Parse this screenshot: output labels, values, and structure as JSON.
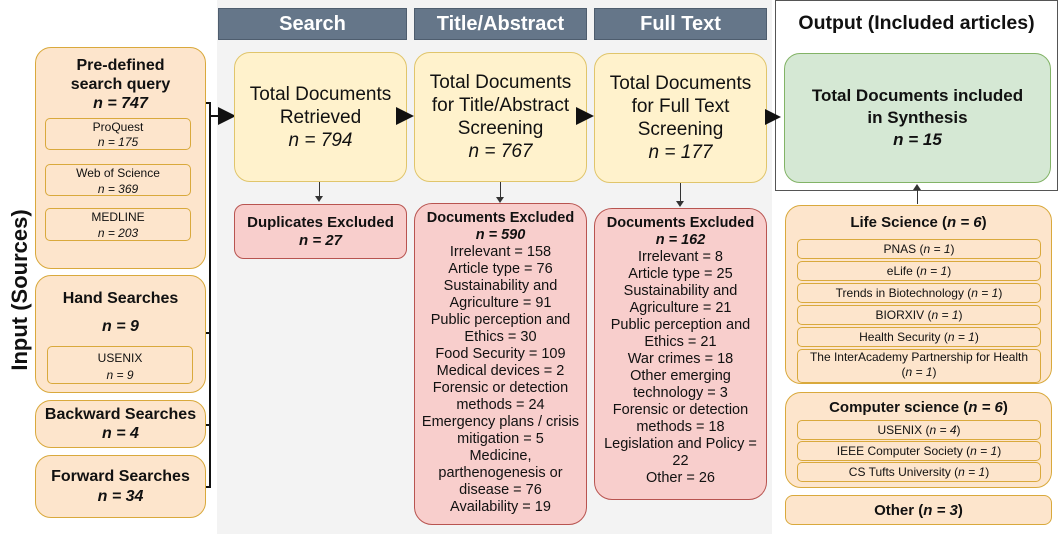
{
  "side_label": "Input (Sources)",
  "stages": {
    "search": "Search",
    "title_abstract": "Title/Abstract",
    "full_text": "Full Text",
    "output": "Output (Included articles)"
  },
  "inputs": {
    "predefined": {
      "title_line1": "Pre-defined",
      "title_line2": "search query",
      "n": "n = 747",
      "sources": [
        {
          "name": "ProQuest",
          "n": "n = 175"
        },
        {
          "name": "Web of Science",
          "n": "n = 369"
        },
        {
          "name": "MEDLINE",
          "n": "n = 203"
        }
      ]
    },
    "hand": {
      "title": "Hand Searches",
      "n": "n = 9",
      "sources": [
        {
          "name": "USENIX",
          "n": "n = 9"
        }
      ]
    },
    "backward": {
      "title": "Backward Searches",
      "n": "n = 4"
    },
    "forward": {
      "title": "Forward Searches",
      "n": "n = 34"
    }
  },
  "flow": {
    "retrieved": {
      "line1": "Total Documents",
      "line2": "Retrieved",
      "n": "n = 794"
    },
    "ta_screen": {
      "line1": "Total Documents",
      "line2": "for Title/Abstract",
      "line3": "Screening",
      "n": "n = 767"
    },
    "ft_screen": {
      "line1": "Total Documents",
      "line2": "for Full Text",
      "line3": "Screening",
      "n": "n = 177"
    },
    "included": {
      "line1": "Total Documents included",
      "line2": "in Synthesis",
      "n": "n = 15"
    }
  },
  "exclusions": {
    "duplicates": {
      "title": "Duplicates Excluded",
      "n": "n = 27"
    },
    "title_abstract": {
      "title": "Documents Excluded",
      "n": "n = 590",
      "lines": [
        "Irrelevant = 158",
        "Article type = 76",
        "Sustainability and",
        "Agriculture = 91",
        "Public perception and",
        "Ethics = 30",
        "Food Security  = 109",
        "Medical devices = 2",
        "Forensic or detection",
        "methods = 24",
        "Emergency plans / crisis",
        "mitigation = 5",
        "Medicine,",
        "parthenogenesis or",
        "disease = 76",
        "Availability = 19"
      ]
    },
    "full_text": {
      "title": "Documents Excluded",
      "n": "n = 162",
      "lines": [
        "Irrelevant = 8",
        "Article type = 25",
        "Sustainability and",
        "Agriculture = 21",
        "Public perception and",
        "Ethics = 21",
        "War crimes  = 18",
        "Other emerging",
        "technology  = 3",
        "Forensic or detection",
        "methods = 18",
        "Legislation and Policy =",
        "22",
        "Other = 26"
      ]
    }
  },
  "output_groups": {
    "life_science": {
      "title": "Life Science (",
      "n": "n = 6",
      "close": ")",
      "items": [
        {
          "name": "PNAS (",
          "n": "n = 1",
          "close": ")"
        },
        {
          "name": "eLife (",
          "n": "n = 1",
          "close": ")"
        },
        {
          "name": "Trends in Biotechnology (",
          "n": "n = 1",
          "close": ")"
        },
        {
          "name": "BIORXIV (",
          "n": "n = 1",
          "close": ")"
        },
        {
          "name": "Health Security (",
          "n": "n = 1",
          "close": ")"
        },
        {
          "name": "The InterAcademy Partnership for Health",
          "name2": "(",
          "n": "n = 1",
          "close": ")"
        }
      ]
    },
    "computer_science": {
      "title": "Computer science (",
      "n": "n = 6",
      "close": ")",
      "items": [
        {
          "name": "USENIX (",
          "n": "n = 4",
          "close": ")"
        },
        {
          "name": "IEEE Computer Society (",
          "n": "n = 1",
          "close": ")"
        },
        {
          "name": "CS Tufts University (",
          "n": "n = 1",
          "close": ")"
        }
      ]
    },
    "other": {
      "title": "Other (",
      "n": "n = 3",
      "close": ")"
    }
  },
  "colors": {
    "header": "#657689",
    "flow_box": "#fff2cc",
    "input_box": "#fde5cc",
    "excluded_box": "#f8cecc",
    "included_box": "#d5e8d4"
  }
}
